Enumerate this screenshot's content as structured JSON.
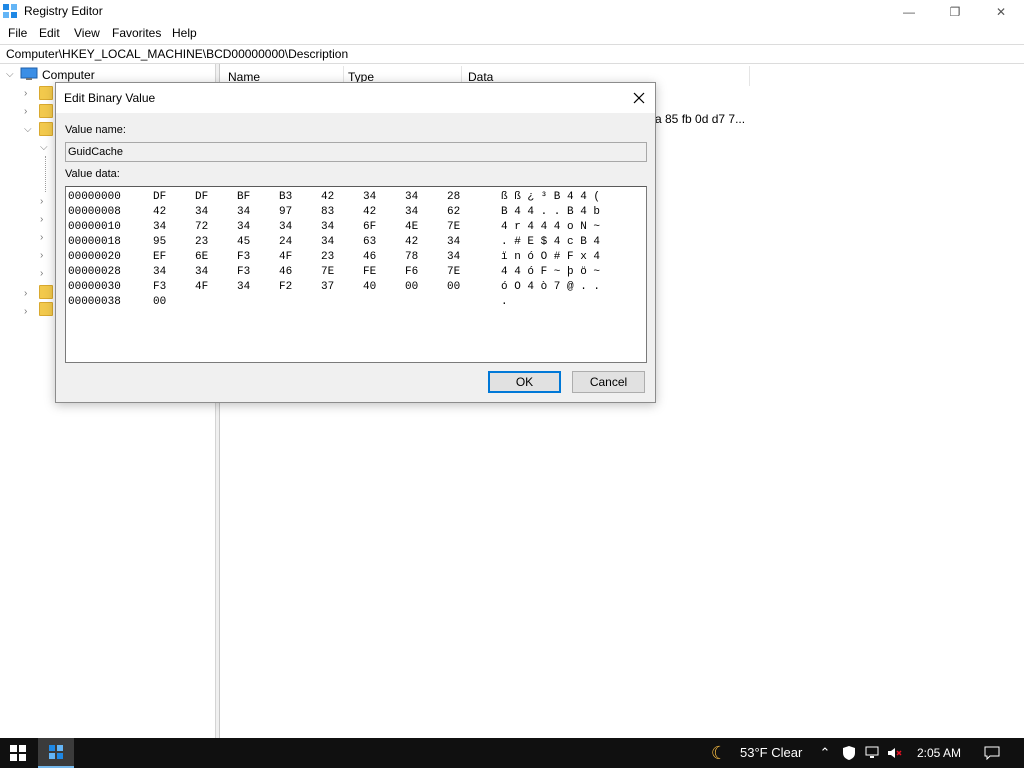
{
  "window": {
    "title": "Registry Editor",
    "controls": {
      "minimize": "—",
      "maximize": "❐",
      "close": "✕"
    }
  },
  "menu": [
    "File",
    "Edit",
    "View",
    "Favorites",
    "Help"
  ],
  "address": "Computer\\HKEY_LOCAL_MACHINE\\BCD00000000\\Description",
  "tree": {
    "root": "Computer"
  },
  "list": {
    "columns": [
      "Name",
      "Type",
      "Data"
    ],
    "visible_data_fragment": "a 85 fb 0d d7 7..."
  },
  "dialog": {
    "title": "Edit Binary Value",
    "value_name_label": "Value name:",
    "value_name": "GuidCache",
    "value_data_label": "Value data:",
    "rows": [
      {
        "offset": "00000000",
        "bytes": [
          "DF",
          "DF",
          "BF",
          "B3",
          "42",
          "34",
          "34",
          "28"
        ],
        "ascii": "ß ß ¿ ³ B 4 4 ("
      },
      {
        "offset": "00000008",
        "bytes": [
          "42",
          "34",
          "34",
          "97",
          "83",
          "42",
          "34",
          "62"
        ],
        "ascii": "B 4 4 . . B 4 b"
      },
      {
        "offset": "00000010",
        "bytes": [
          "34",
          "72",
          "34",
          "34",
          "34",
          "6F",
          "4E",
          "7E"
        ],
        "ascii": "4 r 4 4 4 o N ~"
      },
      {
        "offset": "00000018",
        "bytes": [
          "95",
          "23",
          "45",
          "24",
          "34",
          "63",
          "42",
          "34"
        ],
        "ascii": ". # E $ 4 c B 4"
      },
      {
        "offset": "00000020",
        "bytes": [
          "EF",
          "6E",
          "F3",
          "4F",
          "23",
          "46",
          "78",
          "34"
        ],
        "ascii": "ï n ó O # F x 4"
      },
      {
        "offset": "00000028",
        "bytes": [
          "34",
          "34",
          "F3",
          "46",
          "7E",
          "FE",
          "F6",
          "7E"
        ],
        "ascii": "4 4 ó F ~ þ ö ~"
      },
      {
        "offset": "00000030",
        "bytes": [
          "F3",
          "4F",
          "34",
          "F2",
          "37",
          "40",
          "00",
          "00"
        ],
        "ascii": "ó O 4 ò 7 @ . ."
      },
      {
        "offset": "00000038",
        "bytes": [
          "00"
        ],
        "ascii": "."
      }
    ],
    "ok_label": "OK",
    "cancel_label": "Cancel"
  },
  "taskbar": {
    "weather": "53°F  Clear",
    "time": "2:05 AM"
  }
}
